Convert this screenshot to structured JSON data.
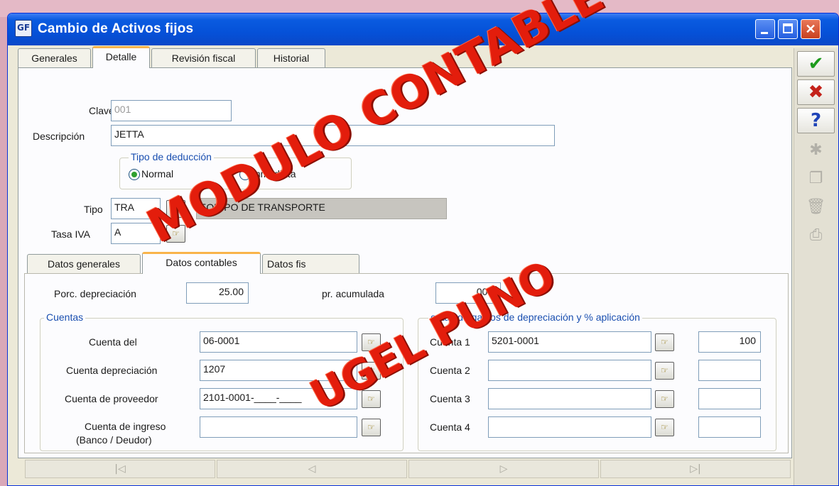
{
  "window": {
    "title": "Cambio de Activos fijos",
    "icon_text": "GF",
    "controls": {
      "minimize": "",
      "maximize": "",
      "close": "✕"
    }
  },
  "tabs": [
    "Generales",
    "Detalle",
    "Revisión fiscal",
    "Historial"
  ],
  "active_tab": "Detalle",
  "fields": {
    "clave": {
      "label": "Clave",
      "value": "001"
    },
    "descripcion": {
      "label": "Descripción",
      "value": "JETTA"
    },
    "tipo_deduccion": {
      "title": "Tipo de deducción",
      "options": [
        "Normal",
        "Inmediata"
      ],
      "selected": "Normal"
    },
    "tipo": {
      "label": "Tipo",
      "value": "TRA",
      "description": "EQUIPO DE TRANSPORTE"
    },
    "tasa_iva": {
      "label": "Tasa IVA",
      "value": "A"
    }
  },
  "subtabs": [
    "Datos generales",
    "Datos contables",
    "Datos fis"
  ],
  "active_subtab": "Datos contables",
  "contables": {
    "porc_depreciacion": {
      "label": "Porc. depreciación",
      "value": "25.00"
    },
    "porc_depr_acumulada": {
      "label_visible": "pr. acumulada",
      "value": "00.0"
    },
    "cuentas": {
      "title": "Cuentas",
      "rows": [
        {
          "label": "Cuenta del",
          "value": "06-0001"
        },
        {
          "label": "Cuenta depreciación",
          "value": "1207"
        },
        {
          "label": "Cuenta de proveedor",
          "value": "2101-0001-____-____"
        },
        {
          "label": "Cuenta de ingreso",
          "label2": "(Banco / Deudor)",
          "value": ""
        }
      ]
    },
    "gastos": {
      "title": "entas de gastos de depreciación  y % aplicación",
      "rows": [
        {
          "label": "Cuenta 1",
          "value": "5201-0001",
          "percent": "100"
        },
        {
          "label": "Cuenta 2",
          "value": "",
          "percent": ""
        },
        {
          "label": "Cuenta 3",
          "value": "",
          "percent": ""
        },
        {
          "label": "Cuenta 4",
          "value": "",
          "percent": ""
        }
      ]
    }
  },
  "toolbar": {
    "accept": "✔",
    "cancel": "✖",
    "help": "?",
    "new": "✱",
    "copy": "❐",
    "delete": "🗑",
    "print": "⎙"
  },
  "navigation": [
    "|◁",
    "◁",
    "▷",
    "▷|"
  ],
  "lookup_icon": "☞",
  "watermark": {
    "line1": "MODULO CONTABLE",
    "line2": "UGEL PUNO"
  }
}
